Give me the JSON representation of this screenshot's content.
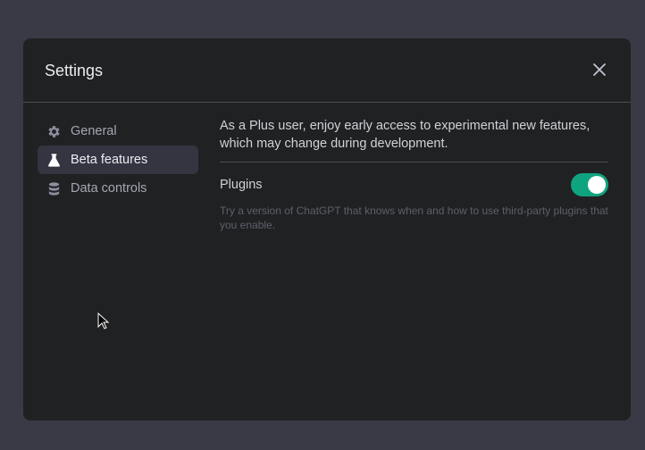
{
  "dialog": {
    "title": "Settings"
  },
  "sidebar": {
    "items": [
      {
        "label": "General",
        "icon": "gear-icon"
      },
      {
        "label": "Beta features",
        "icon": "flask-icon",
        "active": true
      },
      {
        "label": "Data controls",
        "icon": "database-icon"
      }
    ]
  },
  "content": {
    "intro": "As a Plus user, enjoy early access to experimental new features, which may change during development.",
    "plugins": {
      "label": "Plugins",
      "enabled": true,
      "description": "Try a version of ChatGPT that knows when and how to use third-party plugins that you enable."
    }
  },
  "colors": {
    "accent": "#10a37f"
  }
}
